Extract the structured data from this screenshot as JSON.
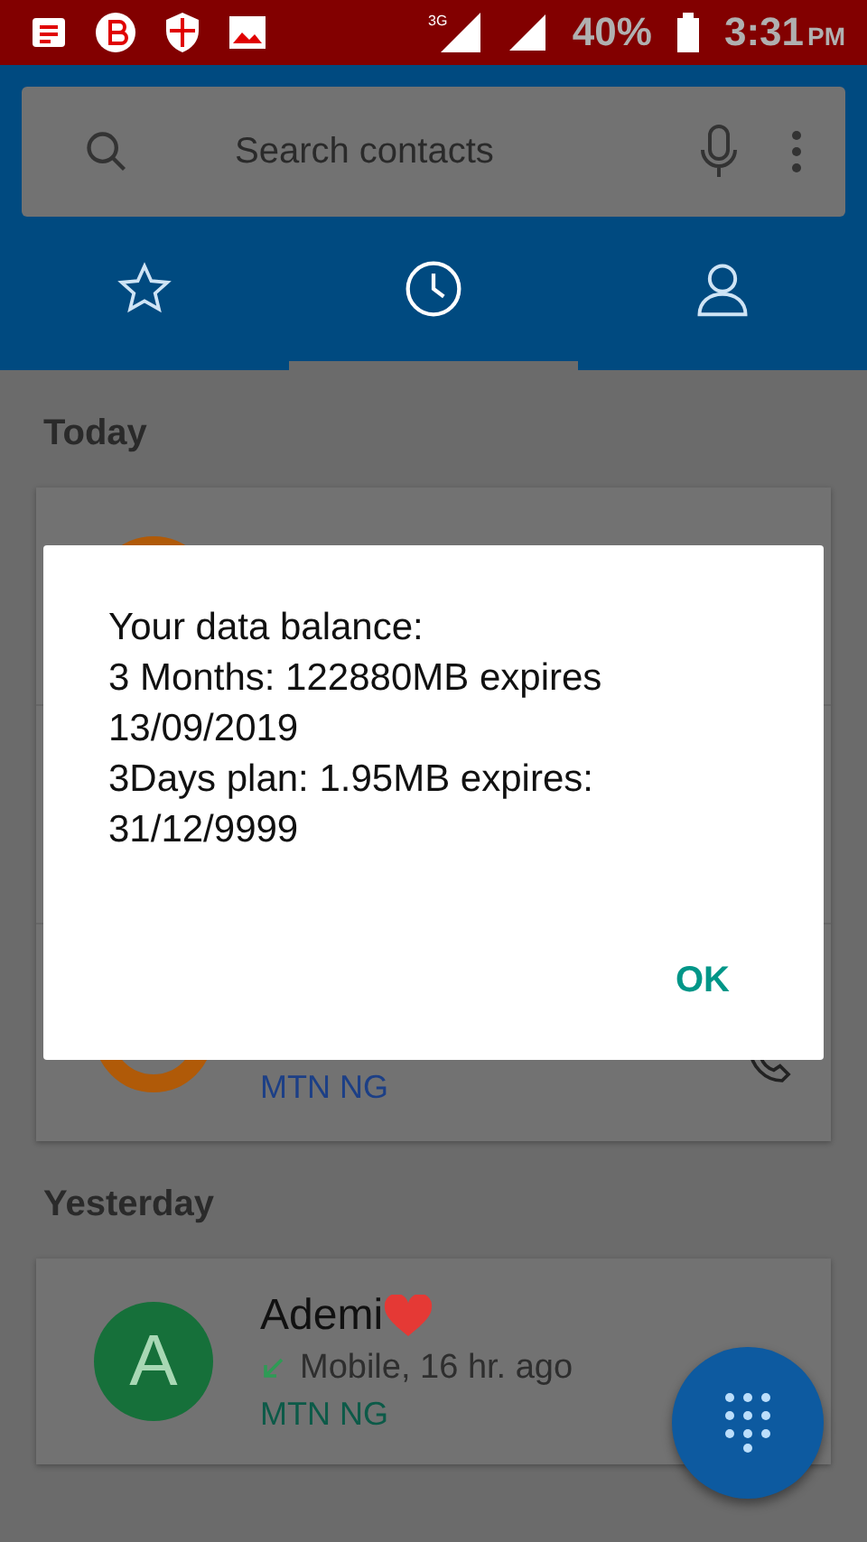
{
  "status_bar": {
    "network": "3G",
    "battery": "40%",
    "time": "3:31",
    "ampm": "PM"
  },
  "search": {
    "placeholder": "Search contacts"
  },
  "tabs": [
    {
      "kind": "favorites",
      "selected": false
    },
    {
      "kind": "recents",
      "selected": true
    },
    {
      "kind": "contacts",
      "selected": false
    }
  ],
  "today": {
    "title": "Today",
    "rows": [
      {
        "color": "#b05a08"
      },
      {},
      {
        "color": "#b05a08",
        "sim": {
          "label": "MTN NG",
          "color": "#1c3f86"
        }
      }
    ]
  },
  "yesterday": {
    "title": "Yesterday",
    "rows": [
      {
        "letter": "A",
        "color": "#16703a",
        "name": "Ademi",
        "detail": "Mobile, 16 hr. ago",
        "sim": {
          "label": "MTN NG",
          "color": "#0c5a48"
        }
      }
    ]
  },
  "dialog": {
    "message": "Your data balance:\n3 Months: 122880MB expires 13/09/2019\n3Days plan: 1.95MB expires:\n31/12/9999",
    "button": "OK"
  }
}
